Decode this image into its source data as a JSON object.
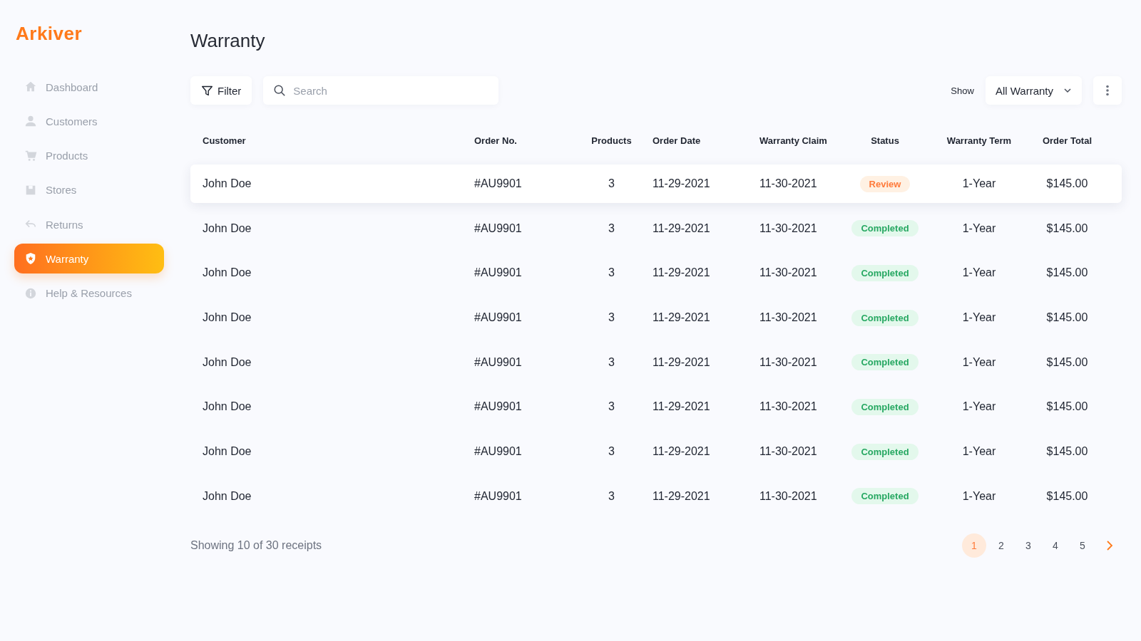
{
  "logo": "Arkiver",
  "sidebar": {
    "items": [
      {
        "label": "Dashboard",
        "selected": false
      },
      {
        "label": "Customers",
        "selected": false
      },
      {
        "label": "Products",
        "selected": false
      },
      {
        "label": "Stores",
        "selected": false
      },
      {
        "label": "Returns",
        "selected": false
      },
      {
        "label": "Warranty",
        "selected": true
      },
      {
        "label": "Help & Resources",
        "selected": false
      }
    ]
  },
  "page_title": "Warranty",
  "toolbar": {
    "filter": "Filter",
    "search": {
      "placeholder": "Search"
    },
    "show_label": "Show",
    "show_select": "All Warranty"
  },
  "table": {
    "columns": [
      "Customer",
      "Order No.",
      "Products",
      "Order Date",
      "Warranty Claim",
      "Status",
      "Warranty Term",
      "Order Total"
    ],
    "rows": [
      {
        "selected": true,
        "customer": "John Doe",
        "order_no": "#AU9901",
        "products": "3",
        "order_date": "11-29-2021",
        "warranty_claim": "11-30-2021",
        "status": {
          "kind": "review",
          "label": "Review"
        },
        "warranty_term": "1-Year",
        "order_total": "$145.00"
      },
      {
        "selected": false,
        "customer": "John Doe",
        "order_no": "#AU9901",
        "products": "3",
        "order_date": "11-29-2021",
        "warranty_claim": "11-30-2021",
        "status": {
          "kind": "completed",
          "label": "Completed"
        },
        "warranty_term": "1-Year",
        "order_total": "$145.00"
      },
      {
        "selected": false,
        "customer": "John Doe",
        "order_no": "#AU9901",
        "products": "3",
        "order_date": "11-29-2021",
        "warranty_claim": "11-30-2021",
        "status": {
          "kind": "completed",
          "label": "Completed"
        },
        "warranty_term": "1-Year",
        "order_total": "$145.00"
      },
      {
        "selected": false,
        "customer": "John Doe",
        "order_no": "#AU9901",
        "products": "3",
        "order_date": "11-29-2021",
        "warranty_claim": "11-30-2021",
        "status": {
          "kind": "completed",
          "label": "Completed"
        },
        "warranty_term": "1-Year",
        "order_total": "$145.00"
      },
      {
        "selected": false,
        "customer": "John Doe",
        "order_no": "#AU9901",
        "products": "3",
        "order_date": "11-29-2021",
        "warranty_claim": "11-30-2021",
        "status": {
          "kind": "completed",
          "label": "Completed"
        },
        "warranty_term": "1-Year",
        "order_total": "$145.00"
      },
      {
        "selected": false,
        "customer": "John Doe",
        "order_no": "#AU9901",
        "products": "3",
        "order_date": "11-29-2021",
        "warranty_claim": "11-30-2021",
        "status": {
          "kind": "completed",
          "label": "Completed"
        },
        "warranty_term": "1-Year",
        "order_total": "$145.00"
      },
      {
        "selected": false,
        "customer": "John Doe",
        "order_no": "#AU9901",
        "products": "3",
        "order_date": "11-29-2021",
        "warranty_claim": "11-30-2021",
        "status": {
          "kind": "completed",
          "label": "Completed"
        },
        "warranty_term": "1-Year",
        "order_total": "$145.00"
      },
      {
        "selected": false,
        "customer": "John Doe",
        "order_no": "#AU9901",
        "products": "3",
        "order_date": "11-29-2021",
        "warranty_claim": "11-30-2021",
        "status": {
          "kind": "completed",
          "label": "Completed"
        },
        "warranty_term": "1-Year",
        "order_total": "$145.00"
      }
    ]
  },
  "footer": {
    "summary": "Showing 10 of 30 receipts",
    "pages": [
      {
        "label": "1",
        "selected": true
      },
      {
        "label": "2",
        "selected": false
      },
      {
        "label": "3",
        "selected": false
      },
      {
        "label": "4",
        "selected": false
      },
      {
        "label": "5",
        "selected": false
      }
    ]
  }
}
